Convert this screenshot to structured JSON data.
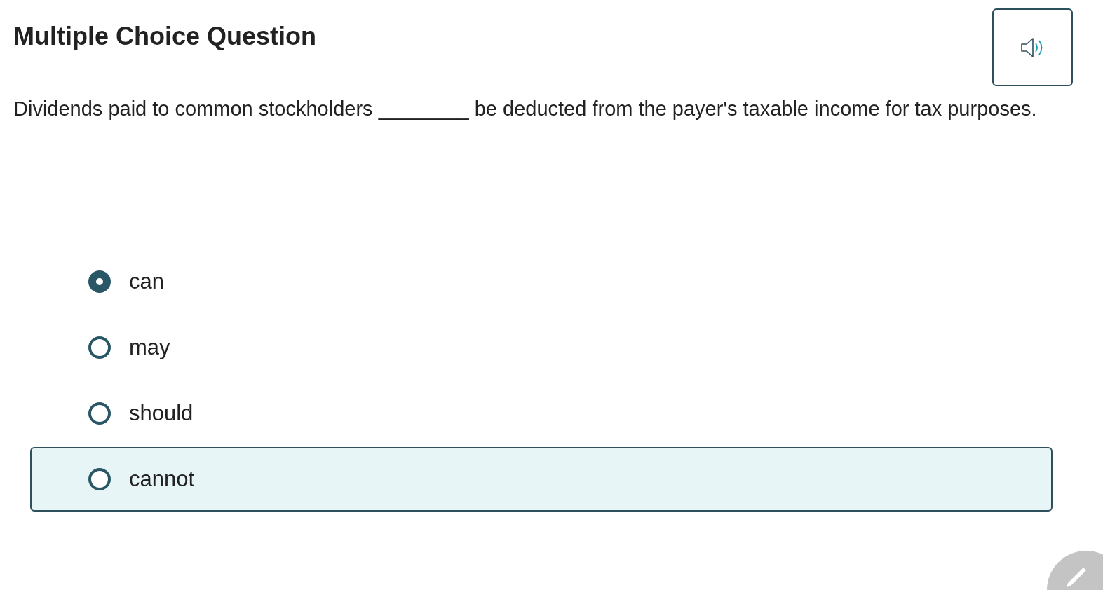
{
  "title": "Multiple Choice Question",
  "question": "Dividends paid to common stockholders ________ be deducted from the payer's taxable income for tax purposes.",
  "options": [
    {
      "label": "can",
      "selected": true,
      "highlighted": false
    },
    {
      "label": "may",
      "selected": false,
      "highlighted": false
    },
    {
      "label": "should",
      "selected": false,
      "highlighted": false
    },
    {
      "label": "cannot",
      "selected": false,
      "highlighted": true
    }
  ]
}
